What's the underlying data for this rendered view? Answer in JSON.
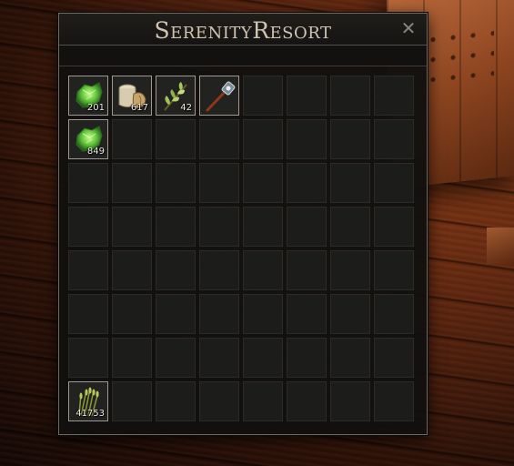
{
  "window": {
    "title": "SerenityResort",
    "close_label": "✕"
  },
  "grid": {
    "columns": 8,
    "rows": 8
  },
  "items": [
    {
      "name": "Green Crystal",
      "icon": "green-crystal-icon",
      "quantity": "201",
      "slot": 0
    },
    {
      "name": "Flour Sack",
      "icon": "sack-icon",
      "quantity": "617",
      "slot": 1
    },
    {
      "name": "Herb Sprig",
      "icon": "herb-icon",
      "quantity": "42",
      "slot": 2
    },
    {
      "name": "Lantern Staff",
      "icon": "staff-icon",
      "quantity": "",
      "slot": 3
    },
    {
      "name": "Green Crystal",
      "icon": "green-crystal-icon",
      "quantity": "849",
      "slot": 8
    },
    {
      "name": "Wheat Bundle",
      "icon": "wheat-icon",
      "quantity": "41753",
      "slot": 56
    }
  ],
  "colors": {
    "panel_bg": "#12110f",
    "slot_bg": "#1c1c1b",
    "slot_filled_border": "#9e9a92",
    "title_color": "#cfc3b2"
  }
}
